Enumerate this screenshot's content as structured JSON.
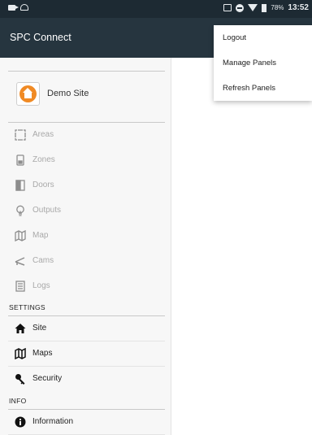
{
  "status_bar": {
    "battery": "78%",
    "time": "13:52"
  },
  "app_bar": {
    "title": "SPC Connect"
  },
  "drawer": {
    "site": {
      "label": "Demo Site"
    },
    "nav_items": [
      {
        "label": "Areas",
        "icon": "areas-icon"
      },
      {
        "label": "Zones",
        "icon": "zones-icon"
      },
      {
        "label": "Doors",
        "icon": "doors-icon"
      },
      {
        "label": "Outputs",
        "icon": "bulb-icon"
      },
      {
        "label": "Map",
        "icon": "map-icon"
      },
      {
        "label": "Cams",
        "icon": "camera-icon"
      },
      {
        "label": "Logs",
        "icon": "logs-icon"
      }
    ],
    "settings": {
      "header": "SETTINGS",
      "items": [
        {
          "label": "Site",
          "icon": "home-icon"
        },
        {
          "label": "Maps",
          "icon": "map-icon"
        },
        {
          "label": "Security",
          "icon": "key-icon"
        }
      ]
    },
    "info": {
      "header": "INFO",
      "items": [
        {
          "label": "Information",
          "icon": "info-icon"
        }
      ]
    }
  },
  "menu": {
    "items": [
      "Logout",
      "Manage Panels",
      "Refresh Panels"
    ]
  }
}
